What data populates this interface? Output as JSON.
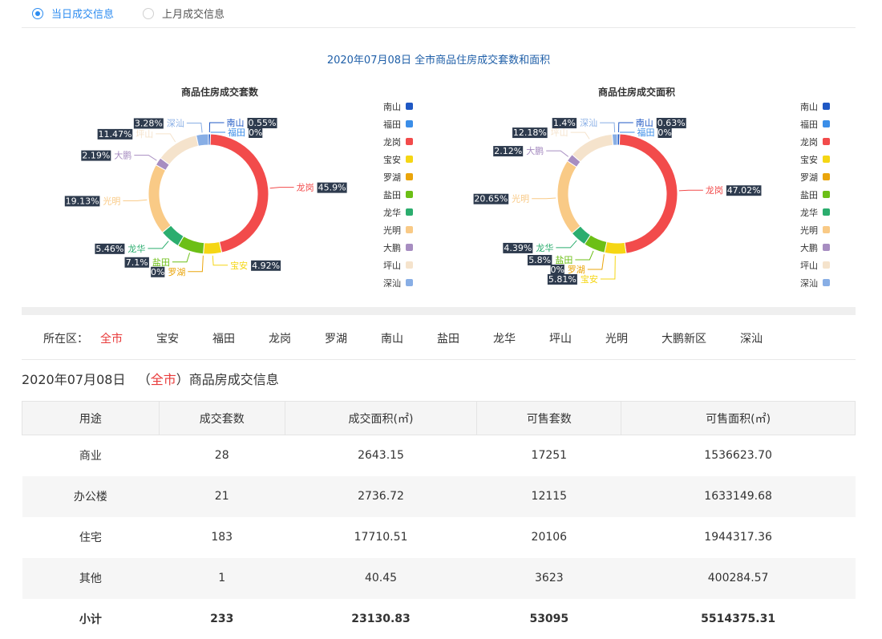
{
  "tabs": [
    {
      "label": "当日成交信息",
      "checked": true
    },
    {
      "label": "上月成交信息",
      "checked": false
    }
  ],
  "chart_heading": "2020年07月08日 全市商品住房成交套数和面积",
  "legend": [
    {
      "name": "南山",
      "color": "#1f58c4"
    },
    {
      "name": "福田",
      "color": "#3b8ee8"
    },
    {
      "name": "龙岗",
      "color": "#f24b4b"
    },
    {
      "name": "宝安",
      "color": "#f5d614"
    },
    {
      "name": "罗湖",
      "color": "#eaa50b"
    },
    {
      "name": "盐田",
      "color": "#6cbf16"
    },
    {
      "name": "龙华",
      "color": "#2bad6e"
    },
    {
      "name": "光明",
      "color": "#f9ca86"
    },
    {
      "name": "大鹏",
      "color": "#a78dc1"
    },
    {
      "name": "坪山",
      "color": "#f5e3cc"
    },
    {
      "name": "深汕",
      "color": "#88aee5"
    }
  ],
  "chart_data": [
    {
      "type": "pie",
      "title": "商品住房成交套数",
      "series": [
        {
          "name": "南山",
          "value": 0.55,
          "label": "0.55%"
        },
        {
          "name": "福田",
          "value": 0,
          "label": "0%"
        },
        {
          "name": "龙岗",
          "value": 45.9,
          "label": "45.9%"
        },
        {
          "name": "宝安",
          "value": 4.92,
          "label": "4.92%"
        },
        {
          "name": "罗湖",
          "value": 0,
          "label": "0%"
        },
        {
          "name": "盐田",
          "value": 7.1,
          "label": "7.1%"
        },
        {
          "name": "龙华",
          "value": 5.46,
          "label": "5.46%"
        },
        {
          "name": "光明",
          "value": 19.13,
          "label": "19.13%"
        },
        {
          "name": "大鹏",
          "value": 2.19,
          "label": "2.19%"
        },
        {
          "name": "坪山",
          "value": 11.47,
          "label": "11.47%"
        },
        {
          "name": "深汕",
          "value": 3.28,
          "label": "3.28%"
        }
      ]
    },
    {
      "type": "pie",
      "title": "商品住房成交面积",
      "series": [
        {
          "name": "南山",
          "value": 0.63,
          "label": "0.63%"
        },
        {
          "name": "福田",
          "value": 0,
          "label": "0%"
        },
        {
          "name": "龙岗",
          "value": 47.02,
          "label": "47.02%"
        },
        {
          "name": "宝安",
          "value": 5.81,
          "label": "5.81%"
        },
        {
          "name": "罗湖",
          "value": 0,
          "label": "0%"
        },
        {
          "name": "盐田",
          "value": 5.8,
          "label": "5.8%"
        },
        {
          "name": "龙华",
          "value": 4.39,
          "label": "4.39%"
        },
        {
          "name": "光明",
          "value": 20.65,
          "label": "20.65%"
        },
        {
          "name": "大鹏",
          "value": 2.12,
          "label": "2.12%"
        },
        {
          "name": "坪山",
          "value": 12.18,
          "label": "12.18%"
        },
        {
          "name": "深汕",
          "value": 1.4,
          "label": "1.4%"
        }
      ]
    }
  ],
  "district_filter": {
    "label": "所在区：",
    "items": [
      "全市",
      "宝安",
      "福田",
      "龙岗",
      "罗湖",
      "南山",
      "盐田",
      "龙华",
      "坪山",
      "光明",
      "大鹏新区",
      "深汕"
    ],
    "active": "全市"
  },
  "info_title": {
    "date": "2020年07月08日",
    "open": "（",
    "district": "全市",
    "rest": "）商品房成交信息"
  },
  "table": {
    "headers": [
      "用途",
      "成交套数",
      "成交面积(㎡)",
      "可售套数",
      "可售面积(㎡)"
    ],
    "rows": [
      [
        "商业",
        "28",
        "2643.15",
        "17251",
        "1536623.70"
      ],
      [
        "办公楼",
        "21",
        "2736.72",
        "12115",
        "1633149.68"
      ],
      [
        "住宅",
        "183",
        "17710.51",
        "20106",
        "1944317.36"
      ],
      [
        "其他",
        "1",
        "40.45",
        "3623",
        "400284.57"
      ]
    ],
    "total": [
      "小计",
      "233",
      "23130.83",
      "53095",
      "5514375.31"
    ]
  }
}
